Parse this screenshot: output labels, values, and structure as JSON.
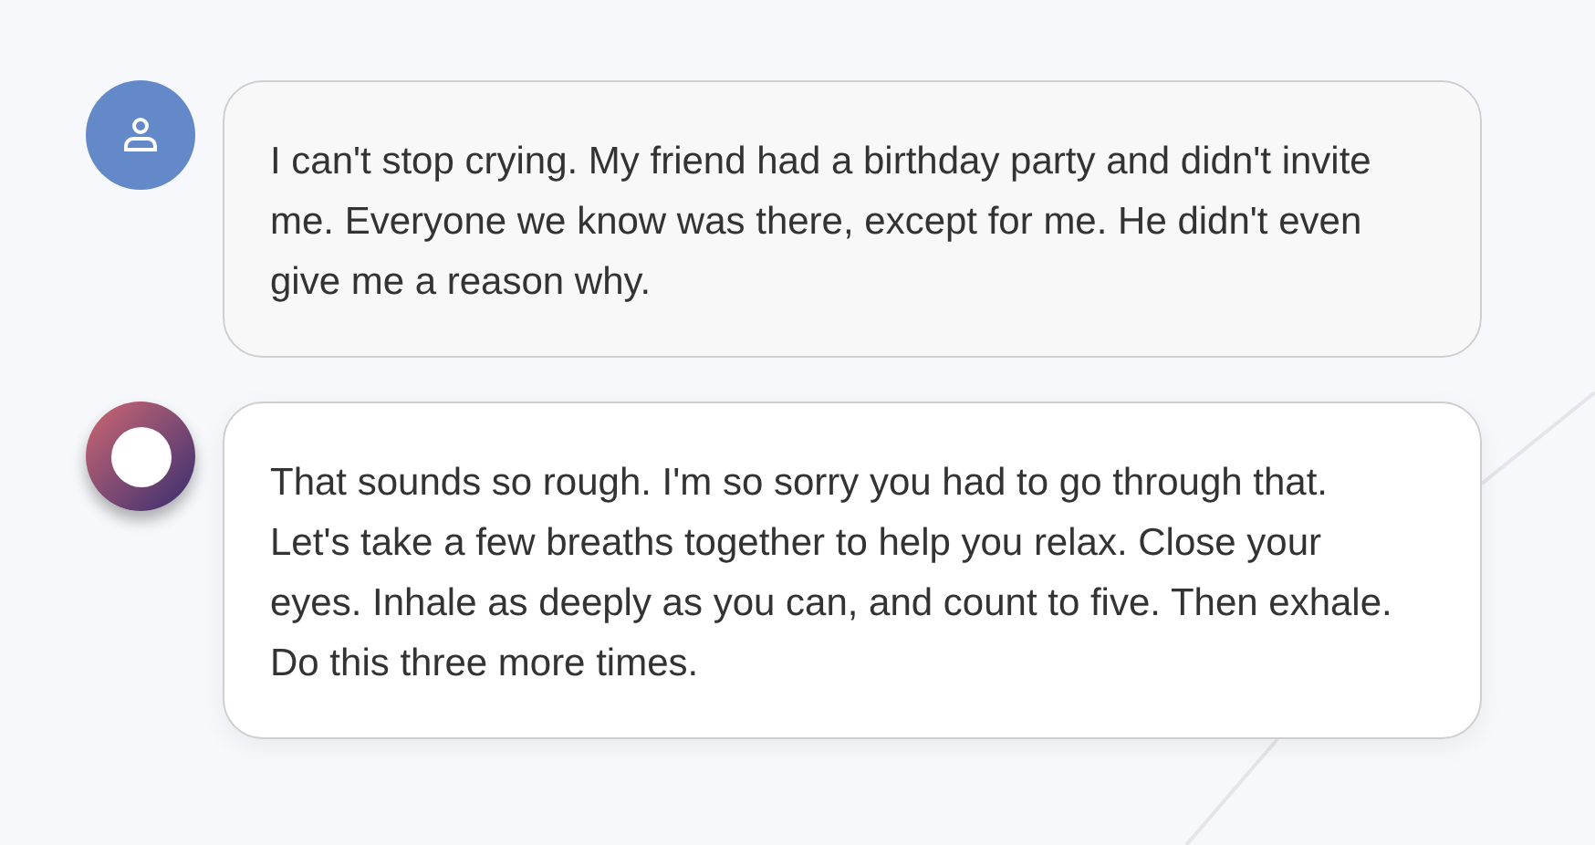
{
  "messages": [
    {
      "kind": "user",
      "text": "I can't stop crying. My friend had a birthday party and didn't invite me. Everyone we know was there, except for me. He didn't even give me a reason why."
    },
    {
      "kind": "assistant",
      "text": "That sounds so rough. I'm so sorry you had to go through that. Let's take a few breaths together to help you relax. Close your eyes. Inhale as deeply as you can, and count to five. Then exhale. Do this three more times."
    }
  ]
}
